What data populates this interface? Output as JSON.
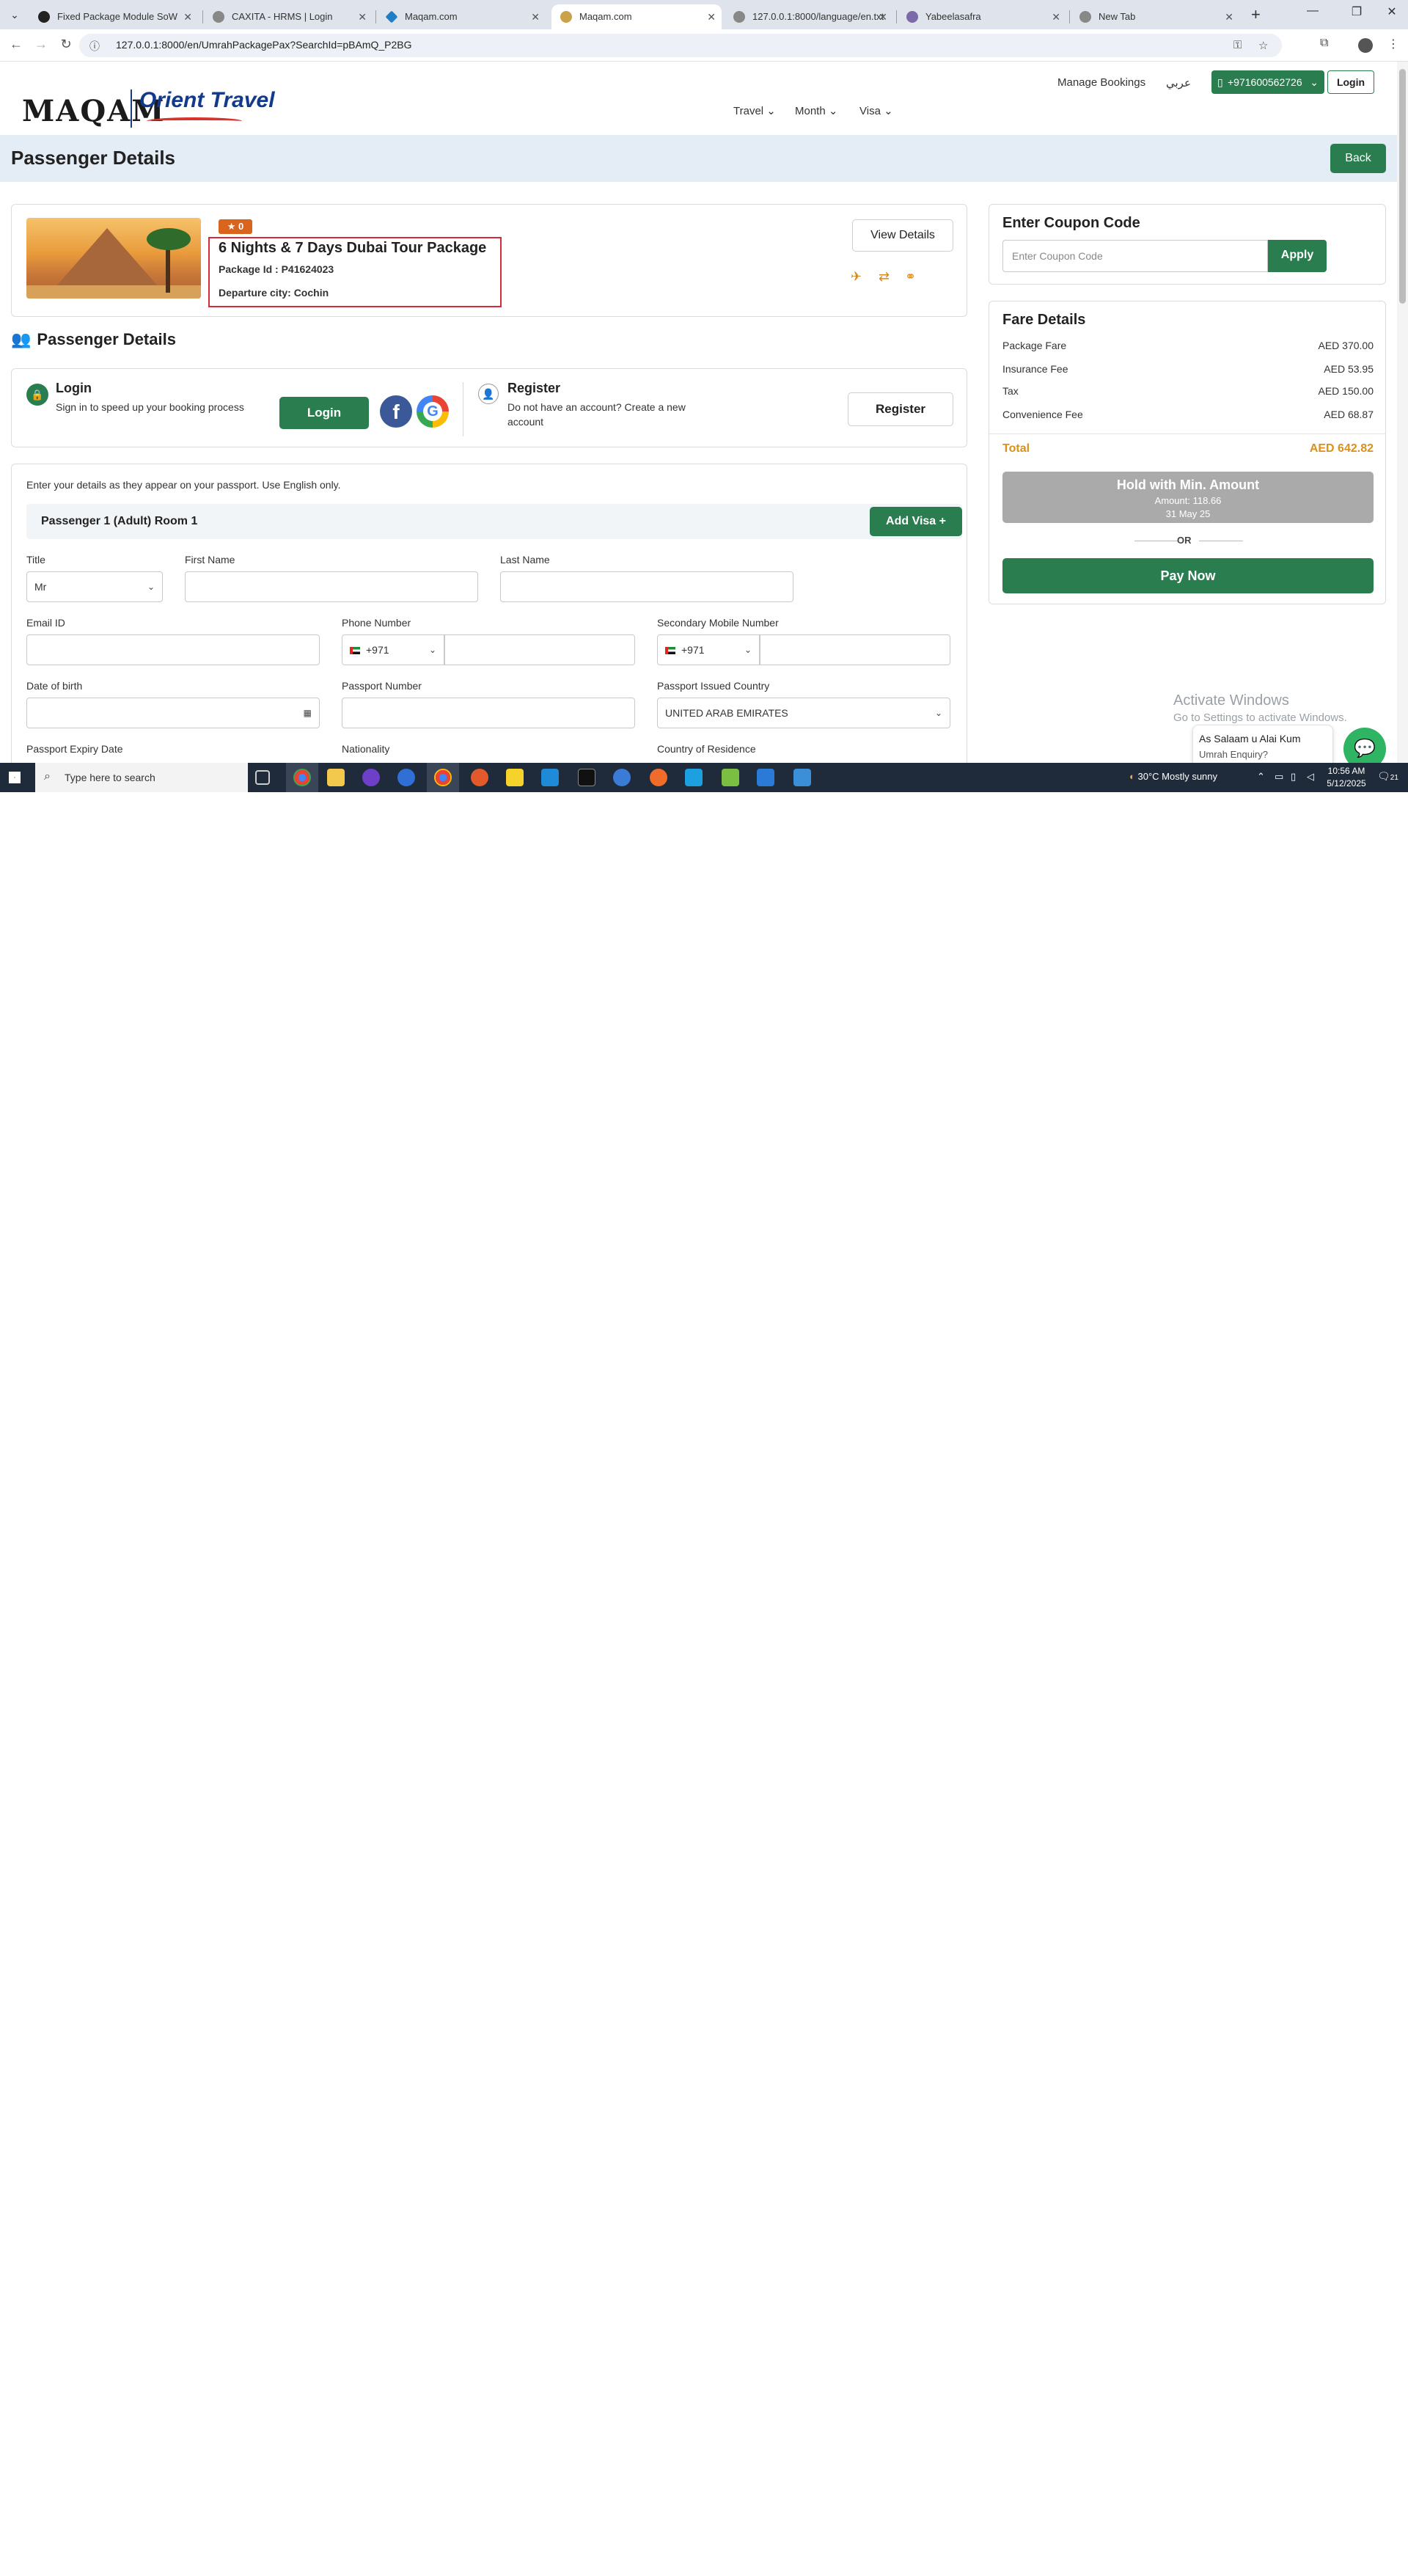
{
  "browser": {
    "tabs": [
      {
        "label": "Fixed Package Module SoW",
        "active": false
      },
      {
        "label": "CAXITA - HRMS | Login",
        "active": false
      },
      {
        "label": "Maqam.com",
        "active": false
      },
      {
        "label": "Maqam.com",
        "active": true
      },
      {
        "label": "127.0.0.1:8000/language/en.txt",
        "active": false
      },
      {
        "label": "Yabeelasafra",
        "active": false
      },
      {
        "label": "New Tab",
        "active": false
      }
    ],
    "url": "127.0.0.1:8000/en/UmrahPackagePax?SearchId=pBAmQ_P2BG"
  },
  "header": {
    "logo_left": "MAQAM",
    "logo_right": "Orient Travel",
    "manage_bookings": "Manage Bookings",
    "arabic": "عربي",
    "phone": "+971600562726",
    "login": "Login",
    "menu": [
      "Travel",
      "Month",
      "Visa"
    ]
  },
  "page": {
    "title": "Passenger Details",
    "back": "Back"
  },
  "package": {
    "rating": "★ 0",
    "title": "6 Nights & 7 Days Dubai Tour Package",
    "package_id": "Package Id : P41624023",
    "departure": "Departure city: Cochin",
    "view_details": "View Details"
  },
  "passenger_section": {
    "title": "Passenger Details",
    "login_title": "Login",
    "login_desc": "Sign in to speed up your booking process",
    "login_button": "Login",
    "register_title": "Register",
    "register_desc": "Do not have an account? Create a new account",
    "register_button": "Register"
  },
  "form": {
    "intro": "Enter your details as they appear on your passport. Use English only.",
    "passenger_label": "Passenger 1 (Adult) Room 1",
    "add_visa": "Add Visa +",
    "title_label": "Title",
    "title_value": "Mr",
    "first_name_label": "First Name",
    "last_name_label": "Last Name",
    "email_label": "Email ID",
    "phone_label": "Phone Number",
    "phone_code": "+971",
    "secondary_label": "Secondary Mobile Number",
    "secondary_code": "+971",
    "dob_label": "Date of birth",
    "passport_label": "Passport Number",
    "issued_country_label": "Passport Issued Country",
    "issued_country_value": "UNITED ARAB EMIRATES",
    "expiry_label": "Passport Expiry Date",
    "nationality_label": "Nationality",
    "residence_label": "Country of Residence"
  },
  "coupon": {
    "title": "Enter Coupon Code",
    "placeholder": "Enter Coupon Code",
    "apply": "Apply"
  },
  "fare": {
    "title": "Fare Details",
    "rows": [
      {
        "label": "Package Fare",
        "value": "AED 370.00"
      },
      {
        "label": "Insurance Fee",
        "value": "AED 53.95"
      },
      {
        "label": "Tax",
        "value": "AED 150.00"
      },
      {
        "label": "Convenience Fee",
        "value": "AED 68.87"
      }
    ],
    "total_label": "Total",
    "total_value": "AED 642.82",
    "hold_title": "Hold with Min. Amount",
    "hold_amount": "Amount: 118.66",
    "hold_date": "31 May 25",
    "or": "OR",
    "pay_now": "Pay Now"
  },
  "overlay": {
    "activate_title": "Activate Windows",
    "activate_sub": "Go to Settings to activate Windows.",
    "chat_line1": "As Salaam u Alai Kum",
    "chat_line2": "Umrah Enquiry?"
  },
  "taskbar": {
    "search": "Type here to search",
    "weather": "30°C  Mostly sunny",
    "time": "10:56 AM",
    "date": "5/12/2025",
    "notif": "21"
  },
  "colors": {
    "primary_green": "#2a7d4f",
    "accent_orange": "#d9901e",
    "highlight_red": "#d42a3a"
  }
}
